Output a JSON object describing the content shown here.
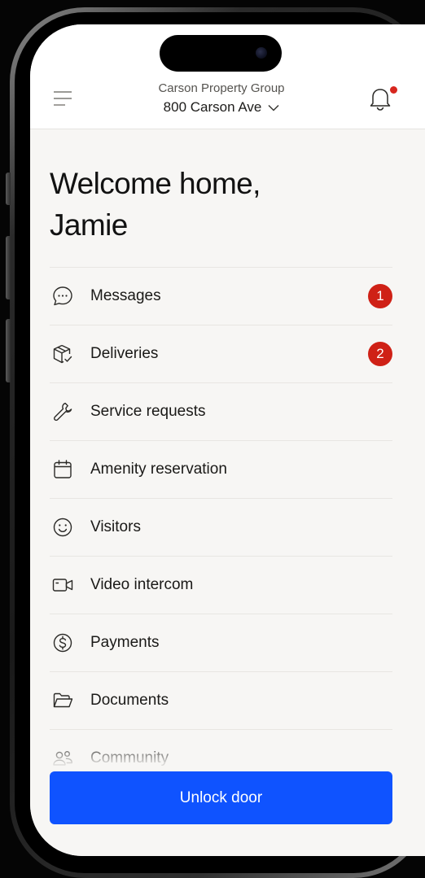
{
  "header": {
    "company": "Carson Property Group",
    "address": "800 Carson Ave"
  },
  "greeting": {
    "line1": "Welcome home,",
    "line2": "Jamie"
  },
  "menu": [
    {
      "label": "Messages",
      "icon": "chat-bubble-icon",
      "badge": "1"
    },
    {
      "label": "Deliveries",
      "icon": "package-icon",
      "badge": "2"
    },
    {
      "label": "Service requests",
      "icon": "wrench-icon"
    },
    {
      "label": "Amenity reservation",
      "icon": "calendar-icon"
    },
    {
      "label": "Visitors",
      "icon": "smiley-icon"
    },
    {
      "label": "Video intercom",
      "icon": "video-camera-icon"
    },
    {
      "label": "Payments",
      "icon": "dollar-circle-icon"
    },
    {
      "label": "Documents",
      "icon": "folder-icon"
    },
    {
      "label": "Community",
      "icon": "people-icon"
    }
  ],
  "actions": {
    "unlock_label": "Unlock door"
  },
  "colors": {
    "accent": "#0f53ff",
    "badge": "#cf2116",
    "background": "#f7f6f4"
  }
}
